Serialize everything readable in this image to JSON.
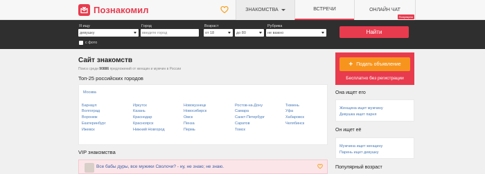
{
  "header": {
    "logo_text": "Познакомил",
    "nav": [
      {
        "label": "ЗНАКОМСТВА"
      },
      {
        "label": "ВСТРЕЧИ"
      },
      {
        "label": "ОНЛАЙН ЧАТ",
        "badge": "Популярно"
      }
    ]
  },
  "search": {
    "fields": [
      {
        "label": "Я ищу",
        "value": "девушку"
      },
      {
        "label": "Город",
        "placeholder": "введите город"
      },
      {
        "label": "Возраст",
        "from": "от 18",
        "to": "до 80"
      },
      {
        "label": "Рубрика",
        "value": "не важно"
      }
    ],
    "photo_label": "с фото",
    "submit": "Найти"
  },
  "main": {
    "title": "Сайт знакомств",
    "sub_prefix": "Поиск среди",
    "sub_count": "90886",
    "sub_suffix": "предложений от женщин и мужчин в России",
    "top_title": "Топ-25 российских городов",
    "capital": "Москва",
    "cities": [
      [
        "Барнаул",
        "Волгоград",
        "Воронеж",
        "Екатеринбург",
        "Ижевск"
      ],
      [
        "Иркутск",
        "Казань",
        "Краснодар",
        "Красноярск",
        "Нижний Новгород"
      ],
      [
        "Новокузнецк",
        "Новосибирск",
        "Омск",
        "Пенза",
        "Пермь"
      ],
      [
        "Ростов-на-Дону",
        "Самара",
        "Санкт-Петербург",
        "Саратов",
        "Томск"
      ],
      [
        "Тюмень",
        "Уфа",
        "Хабаровск",
        "Челябинск"
      ]
    ],
    "vip_title": "VIP знакомства",
    "vip_text": "Все бабы дуры, все мужики Сволочи? - ну, не знаю; не знаю."
  },
  "sidebar": {
    "add_button": "Подать объявление",
    "free_text": "Бесплатно без регистрации",
    "she_seeks_title": "Она ищет его",
    "she_seeks": [
      "Женщина ищет мужчину",
      "Девушка ищет парня"
    ],
    "he_seeks_title": "Он ищет её",
    "he_seeks": [
      "Мужчина ищет женщину",
      "Парень ищет девушку"
    ],
    "popular_title": "Популярный возраст"
  },
  "colors": {
    "accent": "#e83b4e",
    "orange": "#f7941d",
    "link": "#4a7ab8",
    "dark_bar": "#2f2f2f"
  }
}
